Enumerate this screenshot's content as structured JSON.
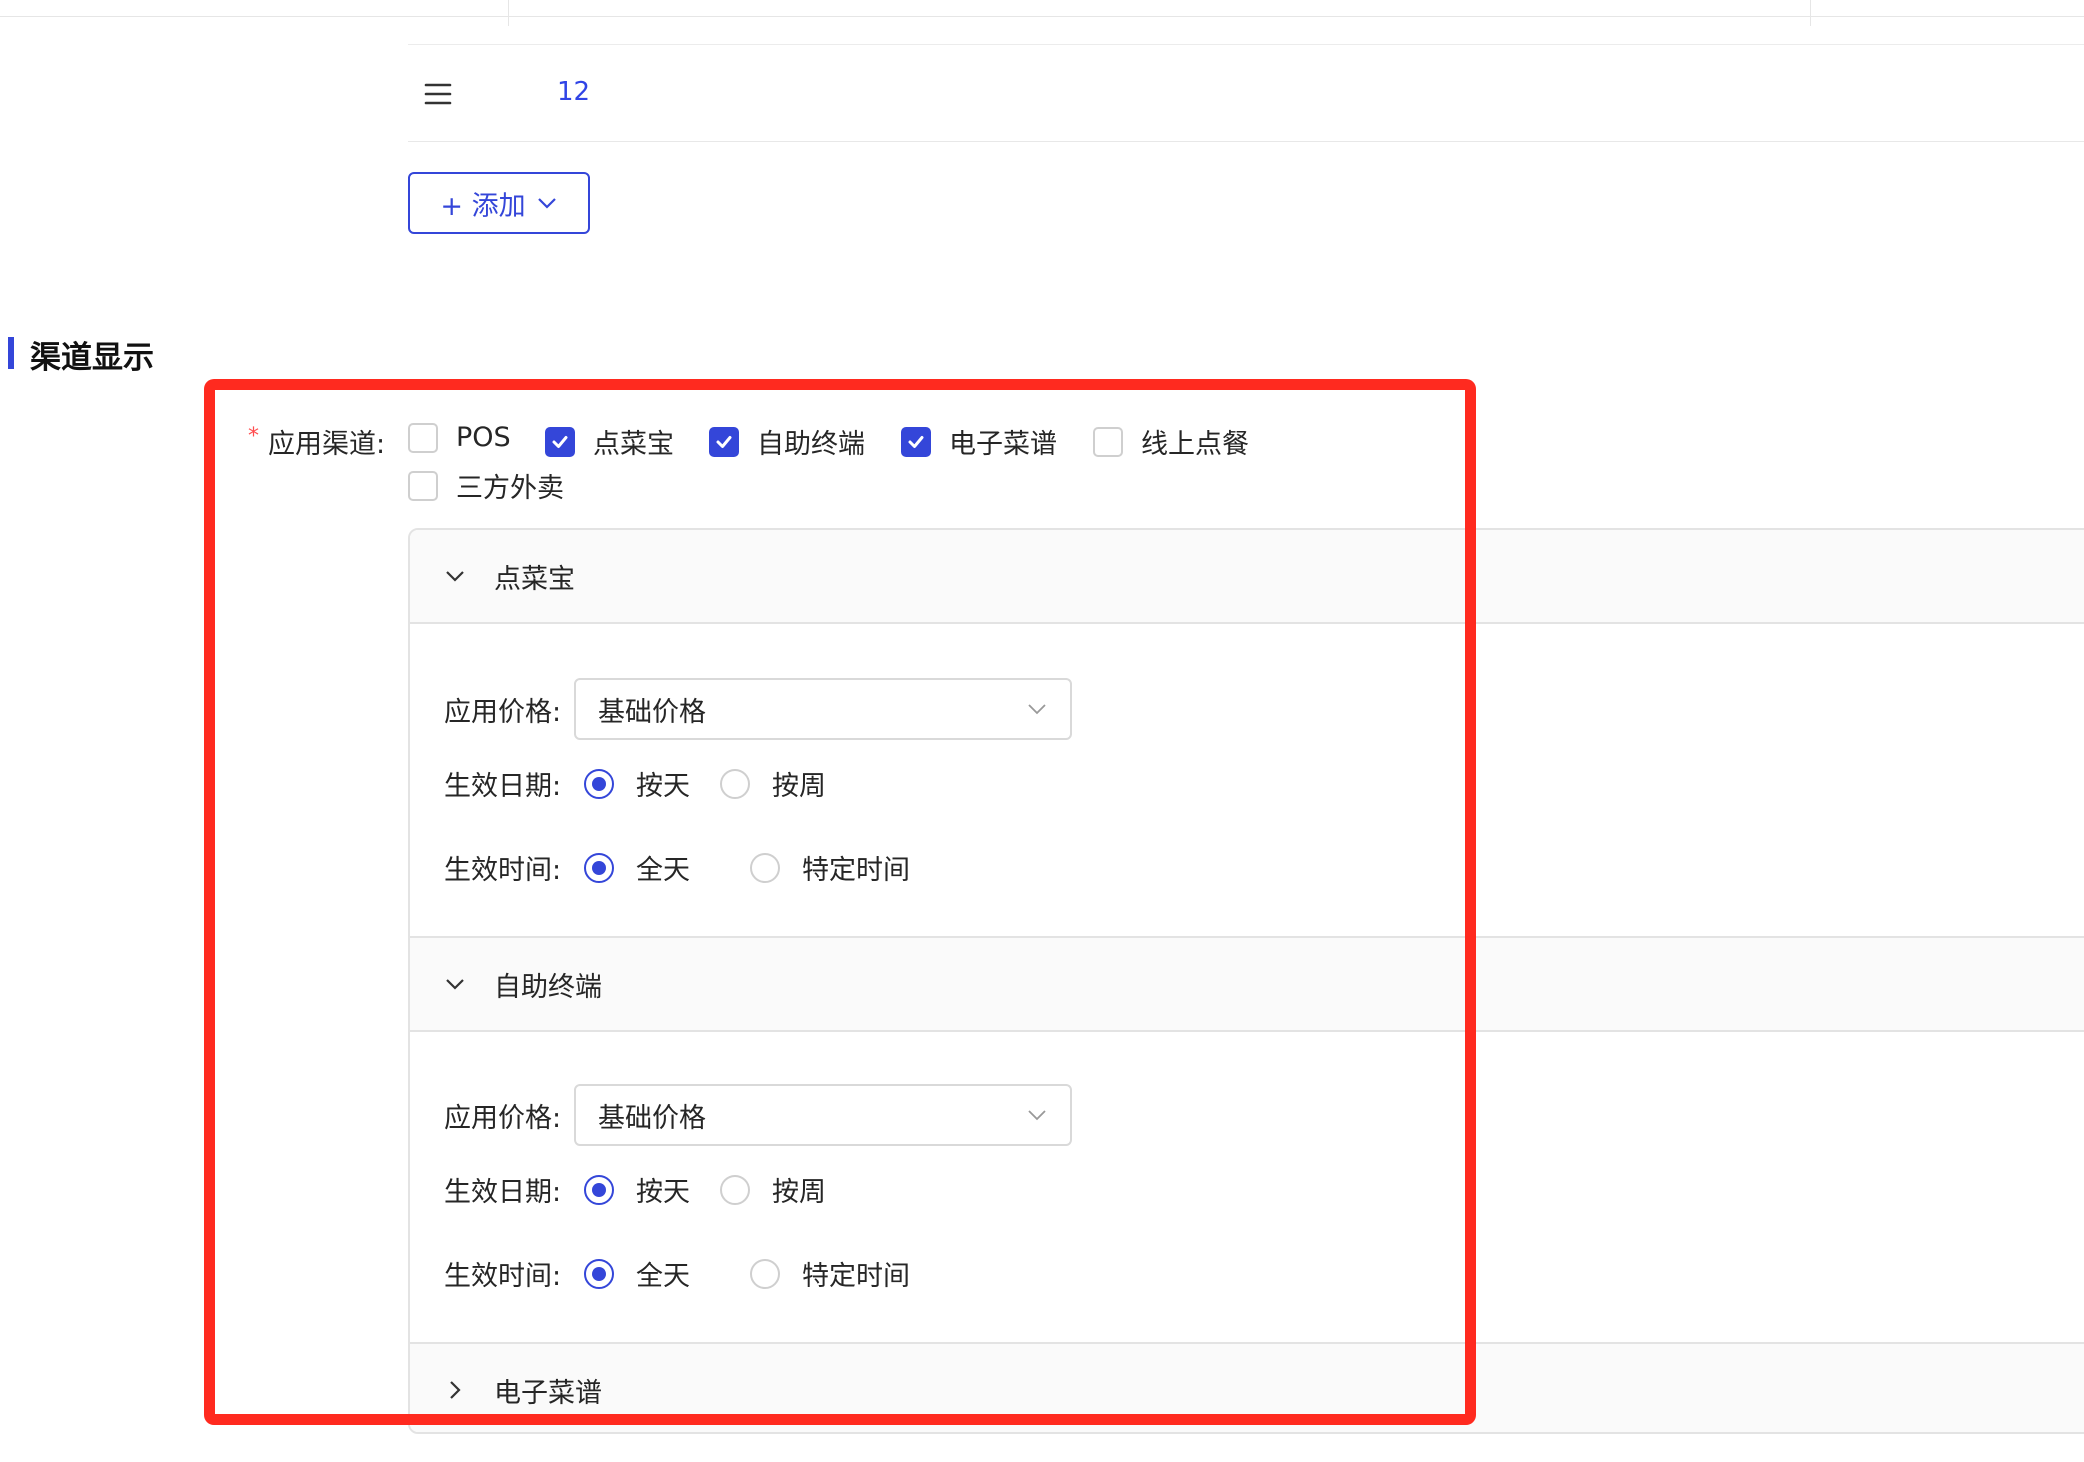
{
  "table": {
    "row_id": "12"
  },
  "add_button": {
    "label": "+ 添加"
  },
  "section": {
    "title": "渠道显示"
  },
  "channels": {
    "label": "应用渠道",
    "required_mark": "*",
    "colon": ":",
    "options": [
      {
        "label": "POS",
        "checked": false
      },
      {
        "label": "点菜宝",
        "checked": true
      },
      {
        "label": "自助终端",
        "checked": true
      },
      {
        "label": "电子菜谱",
        "checked": true
      },
      {
        "label": "线上点餐",
        "checked": false
      },
      {
        "label": "三方外卖",
        "checked": false
      }
    ]
  },
  "panels": [
    {
      "title": "点菜宝",
      "expanded": true,
      "price_label": "应用价格:",
      "price_value": "基础价格",
      "date_label": "生效日期:",
      "date_options": [
        "按天",
        "按周"
      ],
      "date_selected": "按天",
      "time_label": "生效时间:",
      "time_options": [
        "全天",
        "特定时间"
      ],
      "time_selected": "全天"
    },
    {
      "title": "自助终端",
      "expanded": true,
      "price_label": "应用价格:",
      "price_value": "基础价格",
      "date_label": "生效日期:",
      "date_options": [
        "按天",
        "按周"
      ],
      "date_selected": "按天",
      "time_label": "生效时间:",
      "time_options": [
        "全天",
        "特定时间"
      ],
      "time_selected": "全天"
    },
    {
      "title": "电子菜谱",
      "expanded": false
    }
  ],
  "colors": {
    "accent": "#3446d9",
    "highlight": "#ff2a1f",
    "required": "#ff4d4f"
  },
  "icons": {
    "row_handle": "menu-icon",
    "dropdown": "chevron-down-icon",
    "expanded": "chevron-down-icon",
    "collapsed": "chevron-right-icon",
    "checked": "check-icon"
  }
}
